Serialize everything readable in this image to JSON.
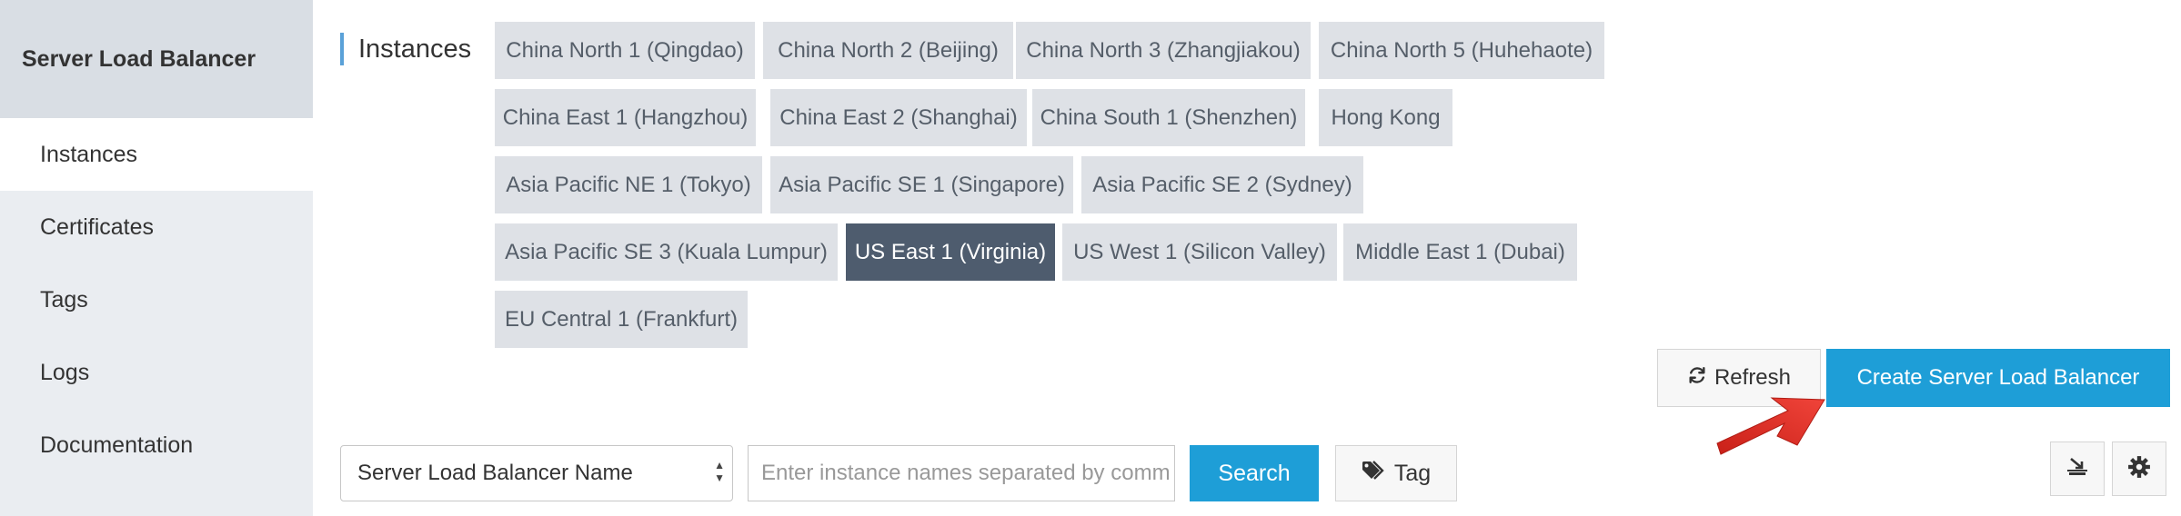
{
  "sidebar": {
    "title": "Server Load Balancer",
    "items": [
      {
        "label": "Instances"
      },
      {
        "label": "Certificates"
      },
      {
        "label": "Tags"
      },
      {
        "label": "Logs"
      },
      {
        "label": "Documentation"
      }
    ]
  },
  "main": {
    "title": "Instances",
    "regions": [
      {
        "label": "China North 1 (Qingdao)"
      },
      {
        "label": "China North 2 (Beijing)"
      },
      {
        "label": "China North 3 (Zhangjiakou)"
      },
      {
        "label": "China North 5 (Huhehaote)"
      },
      {
        "label": "China East 1 (Hangzhou)"
      },
      {
        "label": "China East 2 (Shanghai)"
      },
      {
        "label": "China South 1 (Shenzhen)"
      },
      {
        "label": "Hong Kong"
      },
      {
        "label": "Asia Pacific NE 1 (Tokyo)"
      },
      {
        "label": "Asia Pacific SE 1 (Singapore)"
      },
      {
        "label": "Asia Pacific SE 2 (Sydney)"
      },
      {
        "label": "Asia Pacific SE 3 (Kuala Lumpur)"
      },
      {
        "label": "US East 1 (Virginia)"
      },
      {
        "label": "US West 1 (Silicon Valley)"
      },
      {
        "label": "Middle East 1 (Dubai)"
      },
      {
        "label": "EU Central 1 (Frankfurt)"
      }
    ],
    "selected_region": "US East 1 (Virginia)"
  },
  "toolbar": {
    "refresh_label": "Refresh",
    "create_label": "Create Server Load Balancer"
  },
  "filter": {
    "select_value": "Server Load Balancer Name",
    "input_placeholder": "Enter instance names separated by comm",
    "search_label": "Search",
    "tag_label": "Tag"
  },
  "icons": {
    "refresh": "refresh-icon",
    "tag": "tag-icon",
    "export": "export-icon",
    "settings": "gear-icon",
    "annotation": "red-arrow"
  },
  "colors": {
    "primary": "#1e9ed7",
    "selected_region": "#4e5c6e",
    "region_bg": "#dee1e6",
    "sidebar_bg": "#eaedf1",
    "arrow": "#e8342a"
  }
}
